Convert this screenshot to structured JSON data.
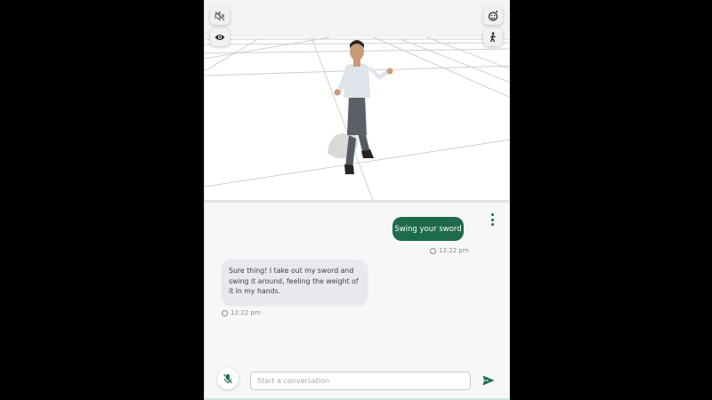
{
  "viewport": {
    "controls": {
      "mute_icon": "speaker-muted-icon",
      "visibility_icon": "eye-icon",
      "emotion_icon": "smiley-face-icon",
      "pose_icon": "walking-person-icon"
    },
    "floor_color": "#ffffff",
    "grid_color": "#c9c9c9"
  },
  "chat": {
    "messages": [
      {
        "role": "user",
        "text": "Swing your sword",
        "time": "12:22 pm"
      },
      {
        "role": "assistant",
        "text": "Sure thing! I take out my sword and swing it around, feeling the weight of it in my hands.",
        "time": "12:22 pm"
      }
    ],
    "input": {
      "value": "",
      "placeholder": "Start a conversation"
    },
    "mic_icon": "microphone-off-icon",
    "send_icon": "send-arrow-icon",
    "menu_icon": "vertical-dots-icon"
  },
  "colors": {
    "accent": "#1d6b4c",
    "bot_bubble": "#e9e8ee",
    "background": "#f7f7f9"
  }
}
